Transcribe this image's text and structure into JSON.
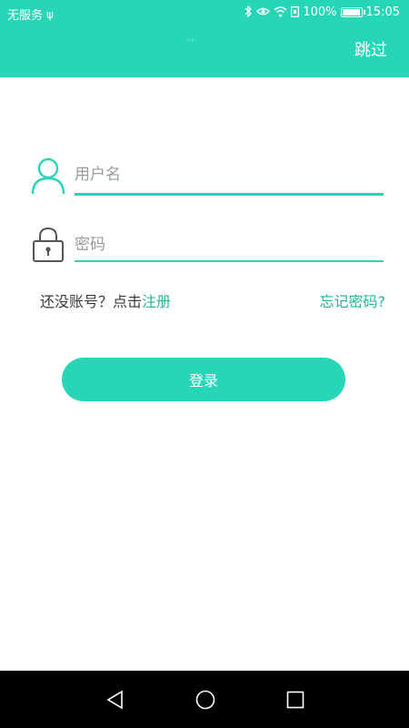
{
  "status_bar": {
    "carrier": "无服务",
    "battery": "100%",
    "battery_level": 1.0,
    "time": "15:05",
    "icons": [
      "usb-icon",
      "bluetooth-icon",
      "eye-icon",
      "wifi-icon",
      "sim-icon",
      "battery-icon"
    ]
  },
  "header": {
    "skip_label": "跳过",
    "accent_color": "#26d6b6"
  },
  "form": {
    "username": {
      "placeholder": "用户名",
      "value": "",
      "icon": "user-icon"
    },
    "password": {
      "placeholder": "密码",
      "value": "",
      "icon": "lock-icon"
    }
  },
  "links": {
    "prompt": "还没账号？点击",
    "register": "注册",
    "forgot": "忘记密码?"
  },
  "login_button": {
    "label": "登录"
  },
  "nav_bar": {
    "icons": [
      "back-icon",
      "home-icon",
      "recents-icon"
    ]
  }
}
